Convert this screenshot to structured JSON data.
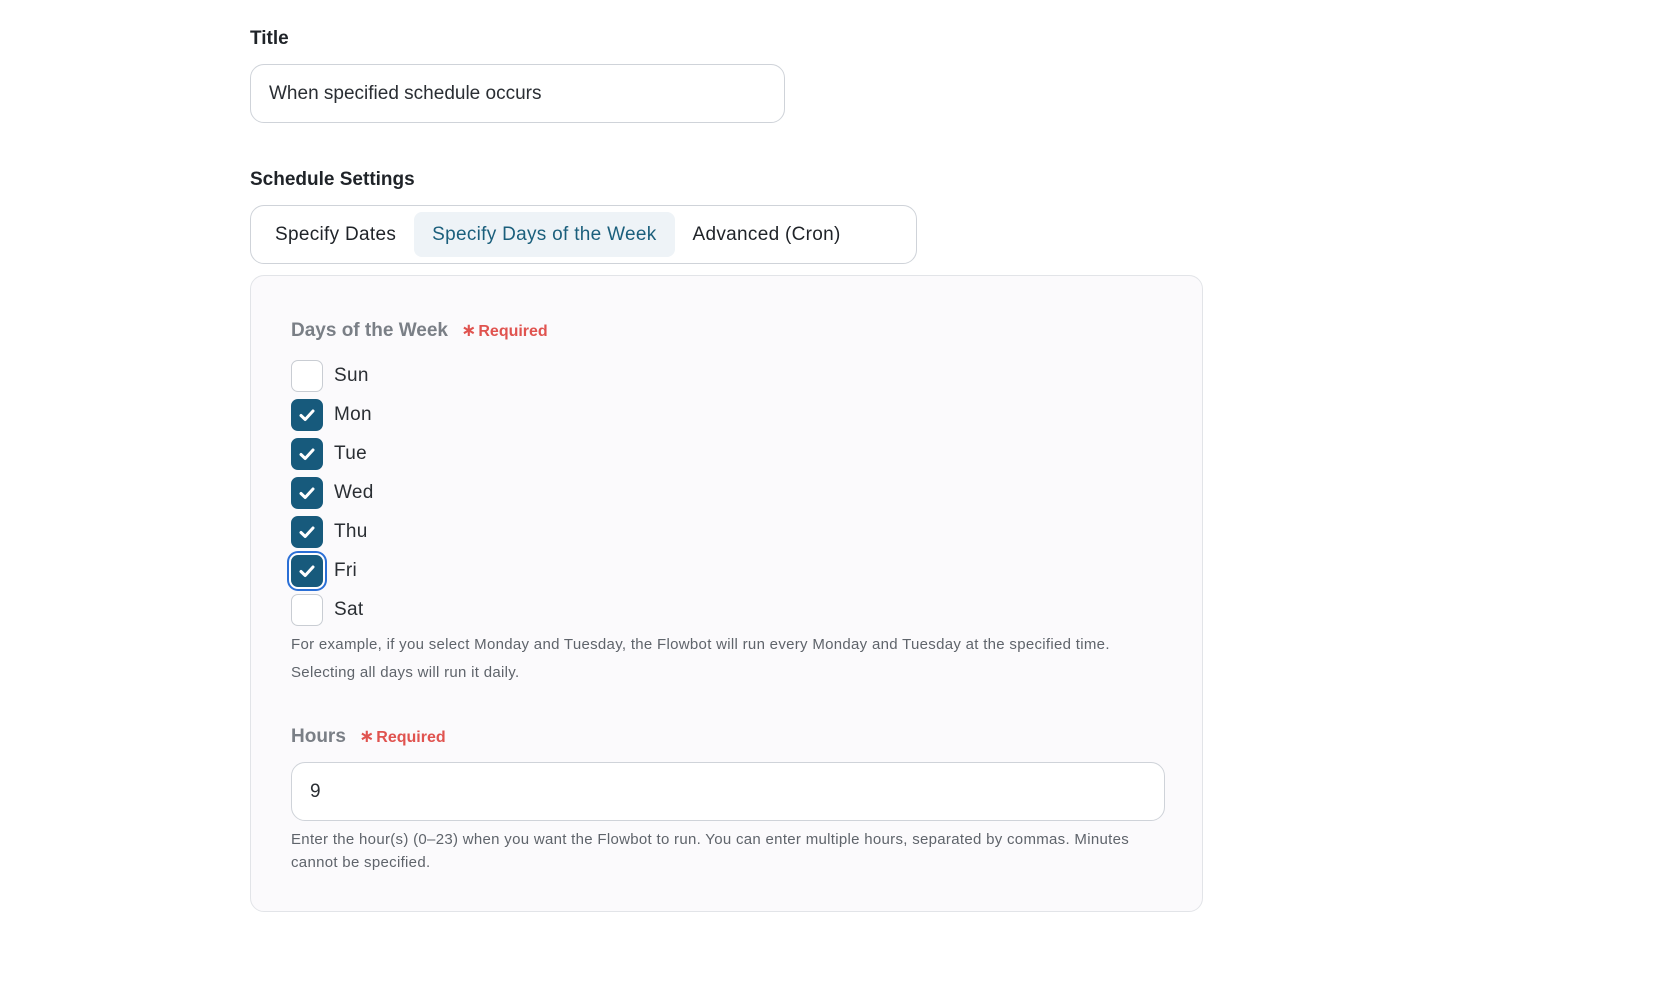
{
  "title_section": {
    "label": "Title",
    "value": "When specified schedule occurs"
  },
  "schedule_section": {
    "label": "Schedule Settings",
    "tabs": [
      {
        "label": "Specify Dates",
        "active": false
      },
      {
        "label": "Specify Days of the Week",
        "active": true
      },
      {
        "label": "Advanced (Cron)",
        "active": false
      }
    ]
  },
  "days_field": {
    "label": "Days of the Week",
    "required_text": "Required",
    "days": [
      {
        "label": "Sun",
        "checked": false
      },
      {
        "label": "Mon",
        "checked": true
      },
      {
        "label": "Tue",
        "checked": true
      },
      {
        "label": "Wed",
        "checked": true
      },
      {
        "label": "Thu",
        "checked": true
      },
      {
        "label": "Fri",
        "checked": true,
        "focused": true
      },
      {
        "label": "Sat",
        "checked": false
      }
    ],
    "help": "For example, if you select Monday and Tuesday, the Flowbot will run every Monday and Tuesday at the specified time. Selecting all days will run it daily."
  },
  "hours_field": {
    "label": "Hours",
    "required_text": "Required",
    "value": "9",
    "help": "Enter the hour(s) (0–23) when you want the Flowbot to run. You can enter multiple hours, separated by commas. Minutes cannot be specified."
  },
  "colors": {
    "accent": "#175a7c",
    "active_tab_text": "#1b5f7c",
    "required": "#e0534f",
    "focus_ring": "#2a6fd6"
  },
  "icons": {
    "checkbox_check": "check-icon",
    "required_marker": "asterisk-icon"
  }
}
